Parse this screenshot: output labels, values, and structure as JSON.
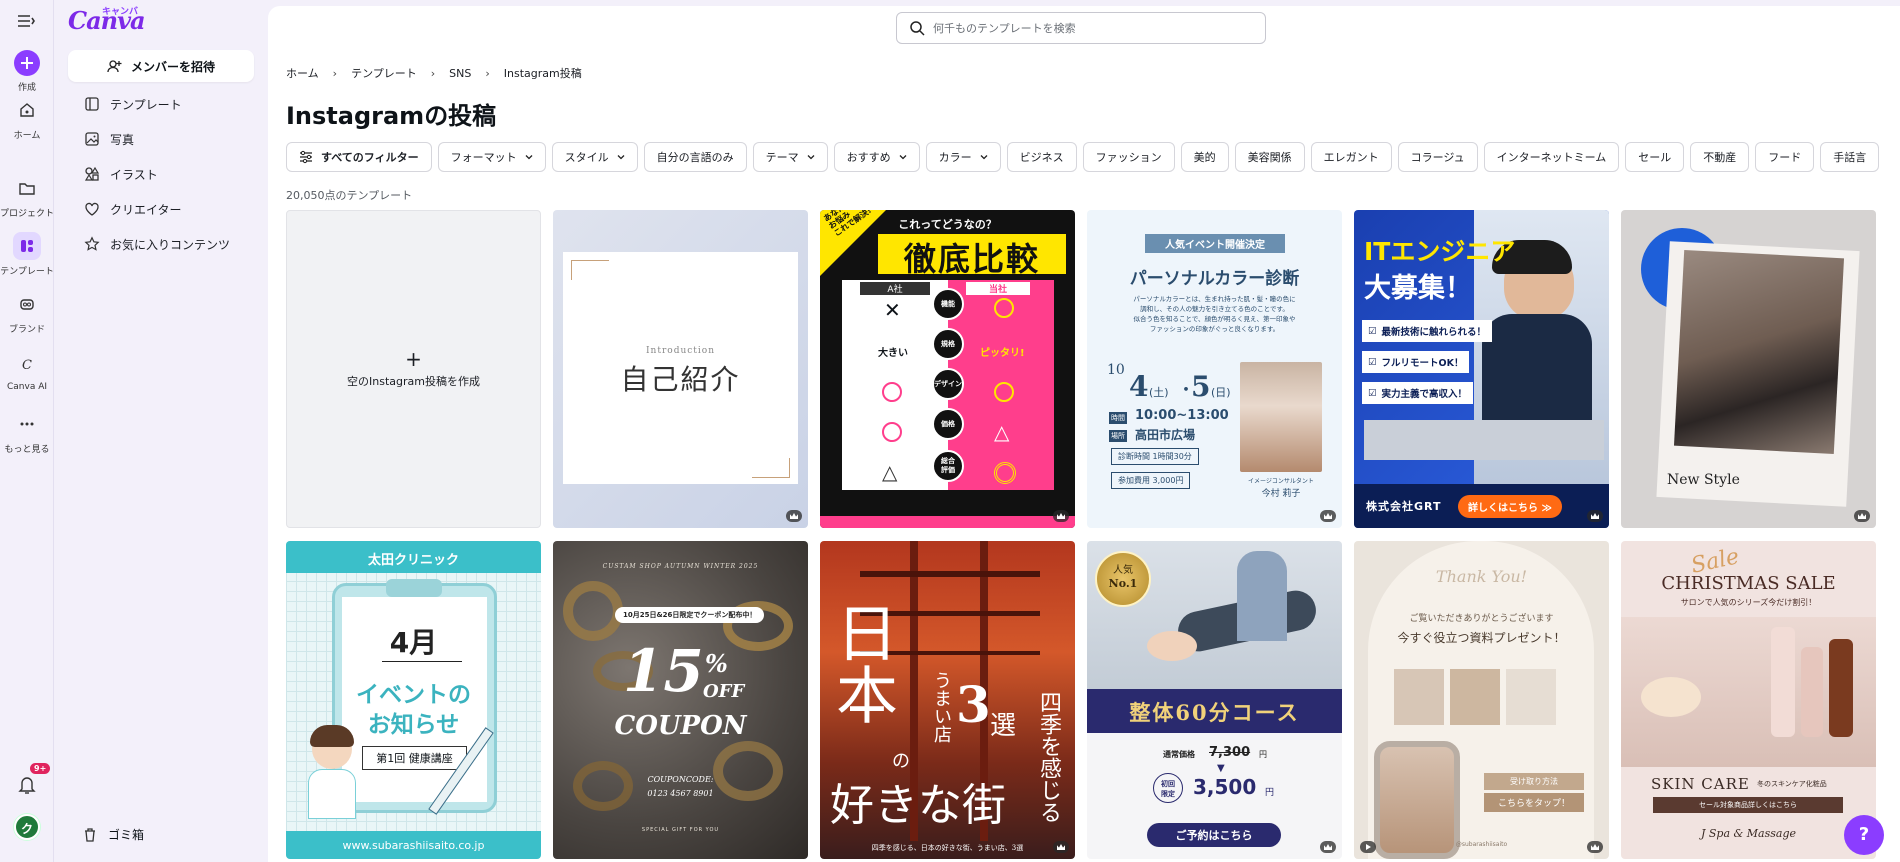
{
  "rail": {
    "create": "作成",
    "home": "ホーム",
    "projects": "プロジェクト",
    "templates": "テンプレート",
    "brand": "ブランド",
    "canva_ai": "Canva AI",
    "more": "もっと見る",
    "notif_badge": "9+",
    "avatar": "ク"
  },
  "panel": {
    "logo": "Canva",
    "logo_kana": "キャンバ",
    "invite": "メンバーを招待",
    "items": [
      "テンプレート",
      "写真",
      "イラスト",
      "クリエイター",
      "お気に入りコンテンツ"
    ],
    "trash": "ゴミ箱"
  },
  "search": {
    "placeholder": "何千ものテンプレートを検索"
  },
  "breadcrumb": [
    "ホーム",
    "テンプレート",
    "SNS",
    "Instagram投稿"
  ],
  "title": "Instagramの投稿",
  "filters": [
    {
      "label": "すべてのフィルター",
      "kind": "all"
    },
    {
      "label": "フォーマット",
      "kind": "dropdown"
    },
    {
      "label": "スタイル",
      "kind": "dropdown"
    },
    {
      "label": "自分の言語のみ",
      "kind": "plain"
    },
    {
      "label": "テーマ",
      "kind": "dropdown"
    },
    {
      "label": "おすすめ",
      "kind": "dropdown"
    },
    {
      "label": "カラー",
      "kind": "dropdown"
    },
    {
      "label": "ビジネス",
      "kind": "plain"
    },
    {
      "label": "ファッション",
      "kind": "plain"
    },
    {
      "label": "美的",
      "kind": "plain"
    },
    {
      "label": "美容関係",
      "kind": "plain"
    },
    {
      "label": "エレガント",
      "kind": "plain"
    },
    {
      "label": "コラージュ",
      "kind": "plain"
    },
    {
      "label": "インターネットミーム",
      "kind": "plain"
    },
    {
      "label": "セール",
      "kind": "plain"
    },
    {
      "label": "不動産",
      "kind": "plain"
    },
    {
      "label": "フード",
      "kind": "plain"
    },
    {
      "label": "手話言",
      "kind": "plain"
    }
  ],
  "count": "20,050点のテンプレート",
  "blank_card": "空のInstagram投稿を作成",
  "cards": {
    "c2": {
      "intro": "Introduction",
      "title": "自己紹介"
    },
    "c3": {
      "badge": "あなたの\nお悩み\nこれで解決!",
      "question": "これってどうなの？",
      "title": "徹底比較",
      "col_a": "A社",
      "col_b": "当社",
      "rows": [
        "機能",
        "規格",
        "デザイン",
        "価格",
        "総合\n評価"
      ],
      "big": "大きい",
      "fit": "ピッタリ!"
    },
    "c4": {
      "ribbon": "人気イベント開催決定",
      "title": "パーソナルカラー診断",
      "body": "パーソナルカラーとは、生まれ持った肌・髪・瞳の色に\n調和し、その人の魅力を引き立てる色のことです。\n似合う色を知ることで、顔色が明るく見え、第一印象や\nファッションの印象がぐっと良くなります。",
      "month": "10",
      "day1": "4",
      "dow1": "(土)",
      "dot": "・",
      "day2": "5",
      "dow2": "(日)",
      "time_label": "時間",
      "time": "10:00~13:00",
      "place_label": "場所",
      "place": "高田市広場",
      "dur": "診断時間  1時間30分",
      "fee": "参加費用  3,000円",
      "consultant": "イメージコンサルタント",
      "name": "今村 莉子"
    },
    "c5": {
      "title1": "ITエンジニア",
      "title2": "大募集！",
      "checks": [
        "最新技術に触れられる！",
        "フルリモートOK！",
        "実力主義で高収入！"
      ],
      "company": "株式会社GRT",
      "cta": "詳しくはこちら ≫"
    },
    "c6": {
      "caption": "New Style"
    },
    "c7": {
      "header": "太田クリニック",
      "month": "4月",
      "event1": "イベントの",
      "event2": "お知らせ",
      "lecture": "第1回 健康講座",
      "url": "www.subarashiisaito.co.jp"
    },
    "c8": {
      "shop": "CUSTAM SHOP AUTUMN WINTER 2025",
      "pill": "10月25日&26日限定でクーポン配布中！",
      "pct": "15",
      "pct_sign": "%",
      "off": "OFF",
      "coupon": "COUPON",
      "code_label": "COUPONCODE:",
      "code": "0123 4567 8901",
      "footer": "SPECIAL GIFT FOR YOU"
    },
    "c9": {
      "big1": "日本",
      "big2": "の",
      "big3": "好きな街",
      "mid": "うまい店",
      "num": "3",
      "sen": "選",
      "side": "四季を感じる",
      "footer": "四季を感じる、日本の好きな街、うまい店、3選"
    },
    "c10": {
      "badge1": "人気",
      "badge2": "No.1",
      "band": "整体60分コース",
      "reg_label": "通常価格",
      "reg": "7,300",
      "yen": "円",
      "lim": "初回\n限定",
      "price": "3,500",
      "cta": "ご予約はこちら"
    },
    "c11": {
      "script": "Thank You!",
      "line1": "ご覧いただきありがとうございます",
      "line2": "今すぐ役立つ資料プレゼント！",
      "how": "受け取り方法",
      "tap": "こちらをタップ！",
      "handle": "@subarashiisaito"
    },
    "c12": {
      "script": "Sale",
      "title": "CHRISTMAS SALE",
      "sub": "サロンで人気のシリーズ今だけ割引！",
      "skin": "SKIN CARE",
      "skin_sub": "冬のスキンケア化粧品",
      "bar": "セール対象商品詳しくはこちら",
      "brand": "J Spa & Massage"
    }
  },
  "help": "?",
  "colors": {
    "accent": "#8b3dff",
    "rail_bg": "#f3f0fa",
    "teal": "#3bbfc9",
    "navy": "#2a2a6e",
    "pink": "#ff3e8c",
    "orange": "#ff6a13",
    "blue": "#1a4fd0"
  }
}
